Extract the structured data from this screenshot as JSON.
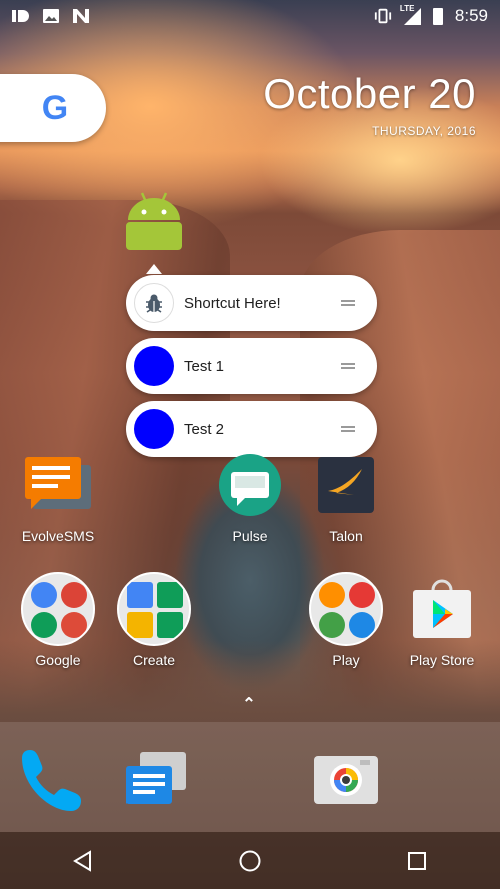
{
  "status_bar": {
    "time": "8:59",
    "network": "LTE",
    "left_icons": [
      "data-icon",
      "image-icon",
      "n-icon"
    ]
  },
  "search": {
    "logo_letter": "G"
  },
  "date_widget": {
    "date": "October 20",
    "weekday": "THURSDAY, 2016"
  },
  "shortcut_popup": {
    "items": [
      {
        "label": "Shortcut Here!",
        "icon": "bug-icon"
      },
      {
        "label": "Test 1",
        "icon": "blue-circle-icon",
        "color": "#0000ff"
      },
      {
        "label": "Test 2",
        "icon": "blue-circle-icon",
        "color": "#0000ff"
      }
    ]
  },
  "apps": {
    "row1": [
      {
        "label": "EvolveSMS"
      },
      {
        "label": "Pulse"
      },
      {
        "label": "Talon"
      }
    ],
    "row2": [
      {
        "label": "Google"
      },
      {
        "label": "Create"
      },
      {
        "label": "Play"
      },
      {
        "label": "Play Store"
      }
    ]
  },
  "dock": {
    "items": [
      "phone-icon",
      "messages-icon",
      "camera-icon"
    ]
  },
  "navigation": {
    "buttons": [
      "back-button",
      "home-button",
      "recents-button"
    ]
  },
  "colors": {
    "accent_blue": "#0000ff",
    "android_green": "#a4c639",
    "pulse_teal": "#1aa386",
    "evolve_orange": "#f57c00"
  }
}
